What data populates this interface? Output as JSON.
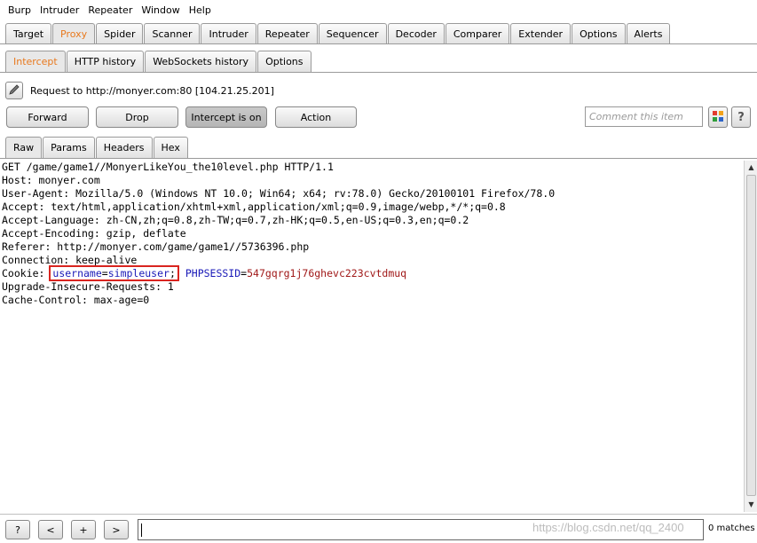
{
  "menubar": [
    "Burp",
    "Intruder",
    "Repeater",
    "Window",
    "Help"
  ],
  "main_tabs": [
    "Target",
    "Proxy",
    "Spider",
    "Scanner",
    "Intruder",
    "Repeater",
    "Sequencer",
    "Decoder",
    "Comparer",
    "Extender",
    "Options",
    "Alerts"
  ],
  "main_tab_active": "Proxy",
  "sub_tabs": [
    "Intercept",
    "HTTP history",
    "WebSockets history",
    "Options"
  ],
  "sub_tab_active": "Intercept",
  "request_label": "Request to http://monyer.com:80  [104.21.25.201]",
  "actions": {
    "forward": "Forward",
    "drop": "Drop",
    "intercept": "Intercept is on",
    "action": "Action"
  },
  "comment_placeholder": "Comment this item",
  "help_label": "?",
  "view_tabs": [
    "Raw",
    "Params",
    "Headers",
    "Hex"
  ],
  "view_tab_active": "Raw",
  "request_lines": [
    "GET /game/game1//MonyerLikeYou_the10level.php HTTP/1.1",
    "Host: monyer.com",
    "User-Agent: Mozilla/5.0 (Windows NT 10.0; Win64; x64; rv:78.0) Gecko/20100101 Firefox/78.0",
    "Accept: text/html,application/xhtml+xml,application/xml;q=0.9,image/webp,*/*;q=0.8",
    "Accept-Language: zh-CN,zh;q=0.8,zh-TW;q=0.7,zh-HK;q=0.5,en-US;q=0.3,en;q=0.2",
    "Accept-Encoding: gzip, deflate",
    "Referer: http://monyer.com/game/game1//5736396.php",
    "Connection: keep-alive"
  ],
  "cookie_line": {
    "prefix": "Cookie: ",
    "c1_name": "username",
    "c1_eq": "=",
    "c1_value": "simpleuser",
    "c1_sep": ";",
    "c2_name": "PHPSESSID",
    "c2_eq": "=",
    "c2_value": "547gqrg1j76ghevc223cvtdmuq"
  },
  "request_lines_after": [
    "Upgrade-Insecure-Requests: 1",
    "Cache-Control: max-age=0"
  ],
  "bottom": {
    "help": "?",
    "prev": "<",
    "add": "+",
    "next": ">",
    "matches": "0 matches",
    "watermark": "https://blog.csdn.net/qq_2400"
  },
  "colors": {
    "active_tab_text": "#e8791e",
    "cookie_name": "#1a1ab8",
    "cookie_value": "#a01818",
    "highlight_box": "#d9241f"
  }
}
